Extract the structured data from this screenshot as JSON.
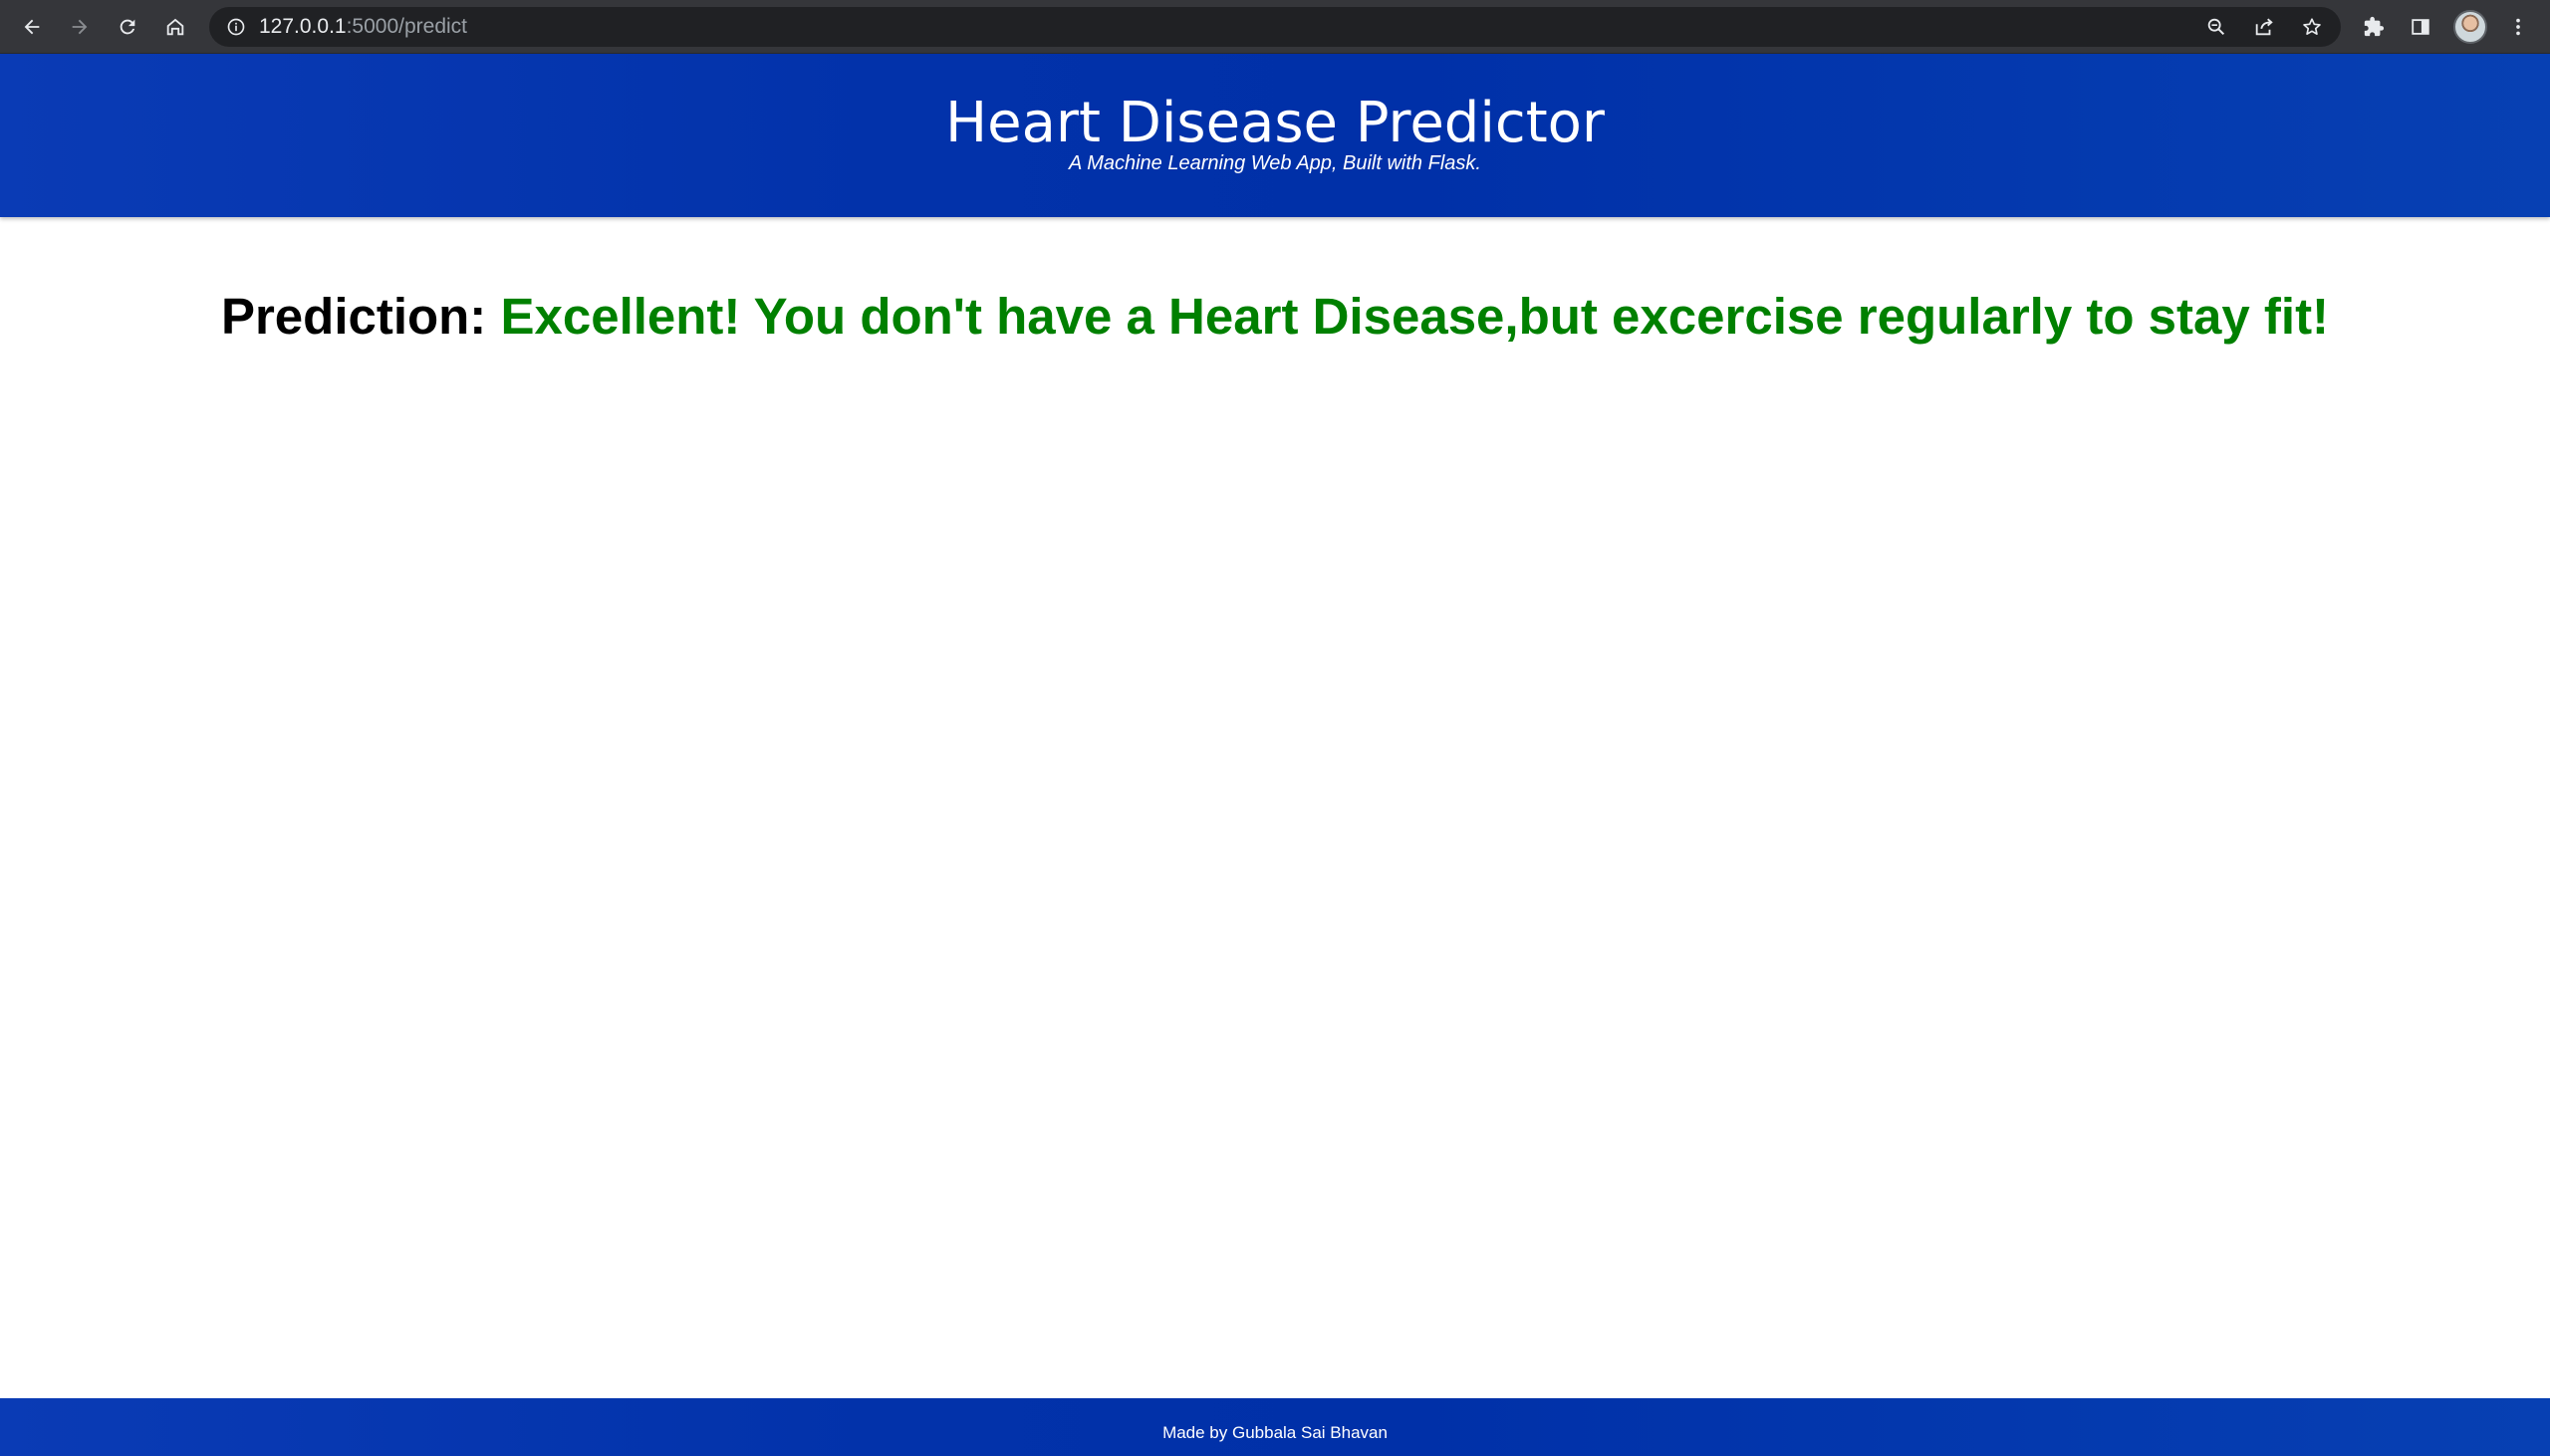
{
  "browser": {
    "url_host": "127.0.0.1",
    "url_path": ":5000/predict",
    "icons": {
      "back": "arrow-left-icon",
      "forward": "arrow-right-icon",
      "reload": "reload-icon",
      "home": "home-icon",
      "site_info": "info-icon",
      "zoom": "zoom-icon",
      "share": "share-icon",
      "bookmark": "star-icon",
      "extensions": "puzzle-icon",
      "side_panel": "side-panel-icon",
      "profile": "avatar",
      "menu": "kebab-menu-icon"
    }
  },
  "header": {
    "title": "Heart Disease Predictor",
    "subtitle": "A Machine Learning Web App, Built with Flask."
  },
  "prediction": {
    "label": "Prediction:",
    "result": "Excellent! You don't have a Heart Disease,but excercise regularly to stay fit!"
  },
  "footer": {
    "text": "Made by Gubbala Sai Bhavan"
  },
  "colors": {
    "header_blue": "#0232aa",
    "result_green": "#008000",
    "chrome_dark": "#35363a"
  }
}
